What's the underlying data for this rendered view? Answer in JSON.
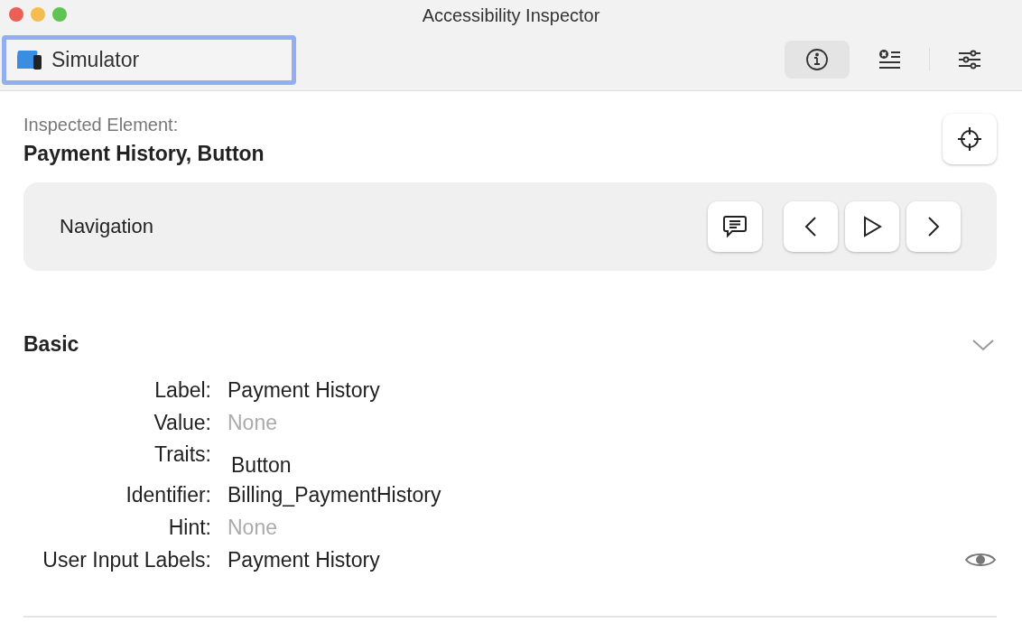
{
  "window": {
    "title": "Accessibility Inspector"
  },
  "target": {
    "label": "Simulator"
  },
  "toolbar": [
    {
      "kind": "info",
      "selected": true
    },
    {
      "kind": "audit",
      "selected": false
    },
    {
      "kind": "settings",
      "selected": false
    }
  ],
  "inspected": {
    "caption": "Inspected Element:",
    "name": "Payment History, Button"
  },
  "navigation": {
    "label": "Navigation"
  },
  "section": {
    "title": "Basic",
    "expanded": true,
    "rows": [
      {
        "label": "Label:",
        "value": "Payment History",
        "muted": false,
        "kind": "text"
      },
      {
        "label": "Value:",
        "value": "None",
        "muted": true,
        "kind": "text"
      },
      {
        "label": "Traits:",
        "value": "Button",
        "muted": false,
        "kind": "trait"
      },
      {
        "label": "Identifier:",
        "value": "Billing_PaymentHistory",
        "muted": false,
        "kind": "text"
      },
      {
        "label": "Hint:",
        "value": "None",
        "muted": true,
        "kind": "text"
      },
      {
        "label": "User Input Labels:",
        "value": "Payment History",
        "muted": false,
        "kind": "eye"
      }
    ]
  }
}
